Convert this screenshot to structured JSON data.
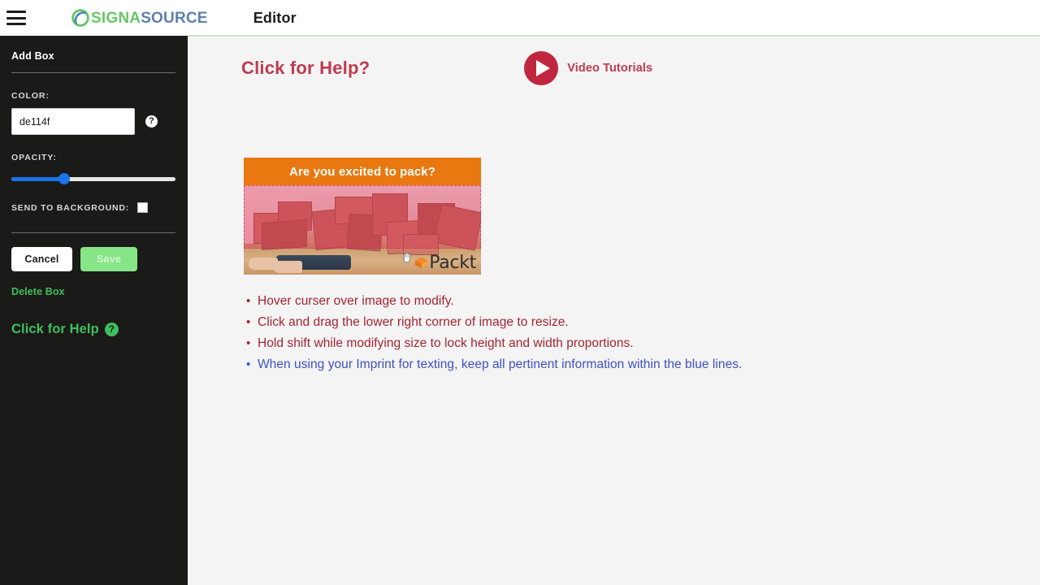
{
  "header": {
    "menu_icon": "hamburger-icon",
    "logo_primary": "SIGNA",
    "logo_secondary": "SOURCE",
    "page_title": "Editor"
  },
  "sidebar": {
    "title": "Add Box",
    "color_label": "COLOR:",
    "color_value": "de114f",
    "color_help_icon": "question-mark-icon",
    "opacity_label": "OPACITY:",
    "opacity_value": 31,
    "send_to_background_label": "SEND TO BACKGROUND:",
    "send_to_background_checked": false,
    "cancel_label": "Cancel",
    "save_label": "Save",
    "delete_label": "Delete Box",
    "help_label": "Click for Help",
    "help_icon": "question-mark-circle-icon"
  },
  "main": {
    "help_heading": "Click for Help?",
    "video_tutorials_label": "Video Tutorials",
    "play_icon": "play-circle-icon",
    "image": {
      "banner_text": "Are you excited to pack?",
      "watermark": "Packt",
      "watermark_icon": "packt-box-icon",
      "cursor_icon": "hand-cursor-icon",
      "overlay_color": "de114f"
    },
    "instructions": [
      {
        "text": "Hover curser over image to modify.",
        "style": "red"
      },
      {
        "text": "Click and drag the lower right corner of image to resize.",
        "style": "red"
      },
      {
        "text": "Hold shift while modifying size to lock height and width proportions.",
        "style": "red"
      },
      {
        "text": "When using your Imprint for texting, keep all pertinent information within the blue lines.",
        "style": "blue"
      }
    ]
  },
  "colors": {
    "sidebar_bg": "#1a1a18",
    "accent_green": "#3fbf5f",
    "save_green": "#86e586",
    "slider_blue": "#1a73e8",
    "help_red": "#bf3a4f",
    "bullet_red": "#a32431",
    "bullet_blue": "#3d50c3",
    "banner_orange": "#e8780f",
    "content_bg": "#f4f4f4"
  }
}
